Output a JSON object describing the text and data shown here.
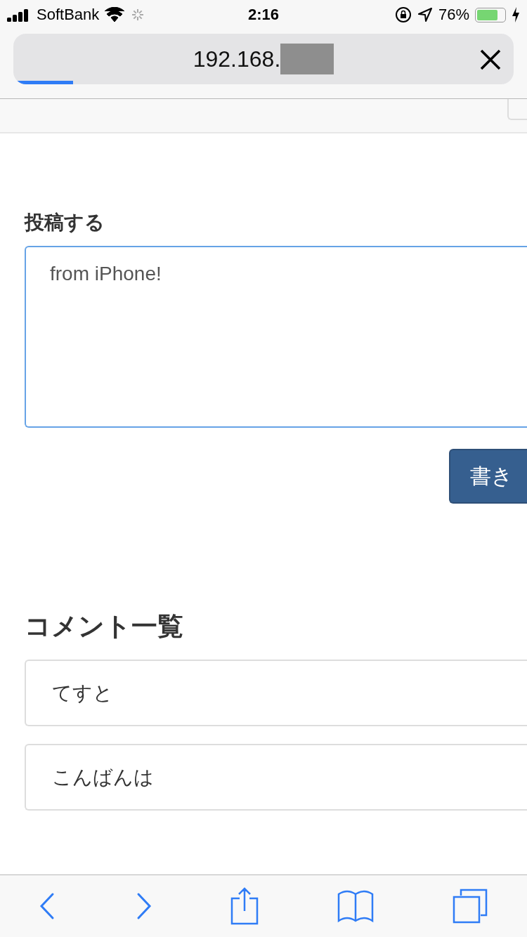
{
  "status_bar": {
    "carrier": "SoftBank",
    "time": "2:16",
    "battery": {
      "text": "76%",
      "level": 0.76
    }
  },
  "url_bar": {
    "address": "192.168.",
    "level": 0.12
  },
  "post_form": {
    "heading": "投稿する",
    "value": "from iPhone!",
    "submit": "書き"
  },
  "comments": {
    "heading": "コメント一覧",
    "items": [
      "てすと",
      "こんばんは"
    ]
  }
}
